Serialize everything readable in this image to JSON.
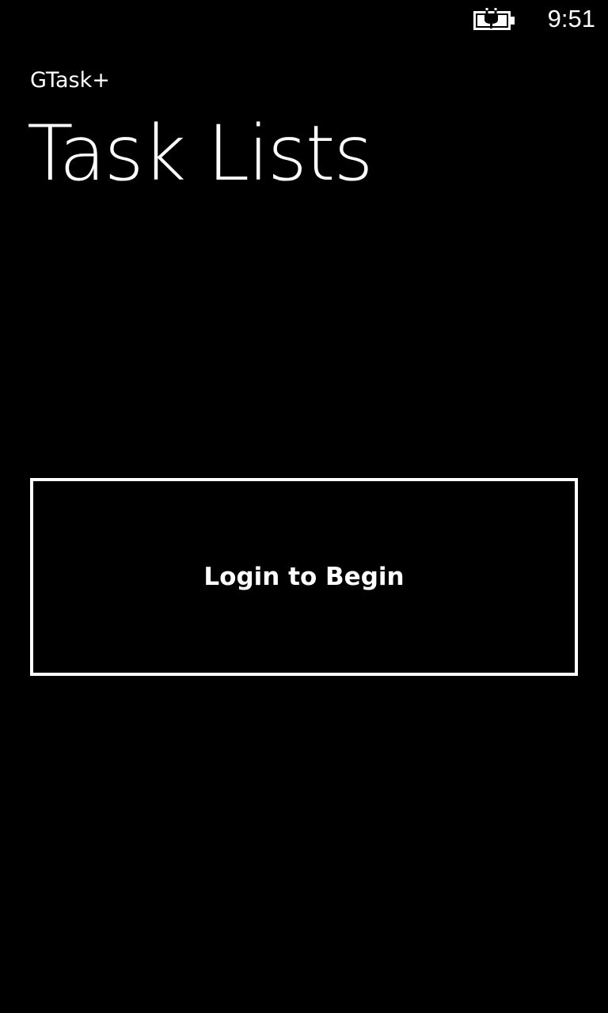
{
  "status_bar": {
    "battery_icon": "battery-charging-icon",
    "time": "9:51"
  },
  "header": {
    "app_name": "GTask+",
    "page_title": "Task Lists"
  },
  "main": {
    "login_button_label": "Login to Begin"
  },
  "colors": {
    "background": "#000000",
    "foreground": "#ffffff"
  }
}
